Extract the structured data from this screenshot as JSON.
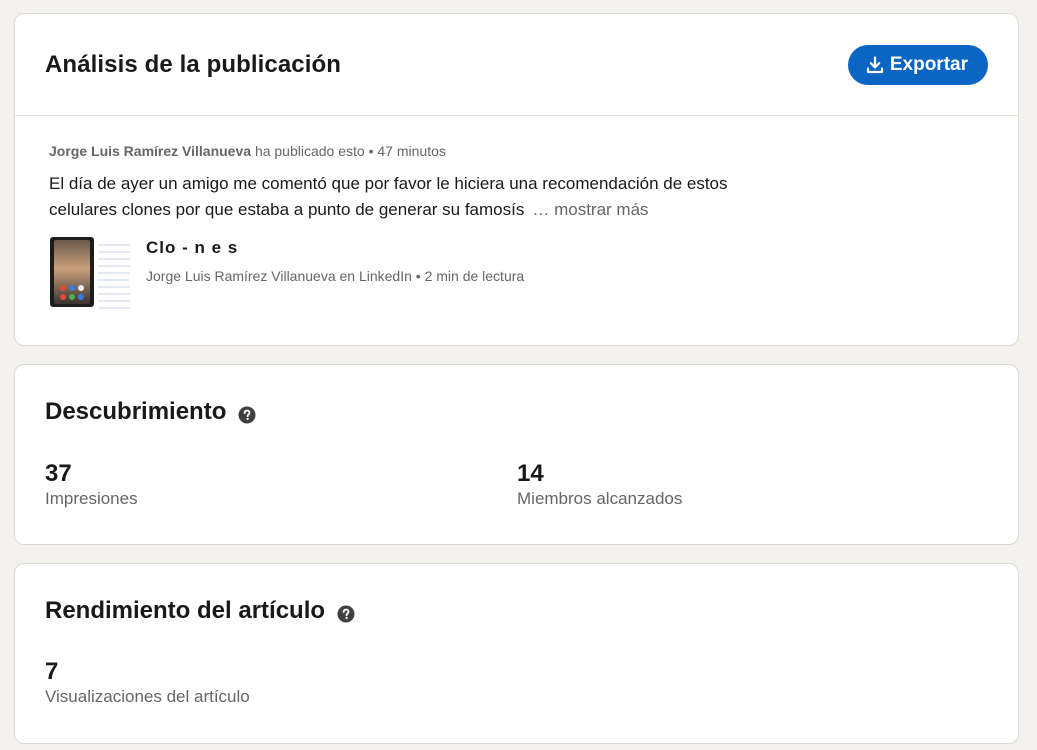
{
  "analysis": {
    "title": "Análisis de la publicación",
    "export_label": "Exportar",
    "post": {
      "author": "Jorge Luis Ramírez Villanueva",
      "action": "ha publicado esto",
      "separator": "•",
      "time": "47 minutos",
      "text": "El día de ayer un amigo me comentó que por favor le hiciera una recomendación de estos celulares clones por que estaba a punto de generar su famosís",
      "show_more": "… mostrar más"
    },
    "article": {
      "title": "Clo - n e s",
      "subtitle": "Jorge Luis Ramírez Villanueva en LinkedIn • 2 min de lectura"
    }
  },
  "discovery": {
    "title": "Descubrimiento",
    "metrics": [
      {
        "value": "37",
        "label": "Impresiones"
      },
      {
        "value": "14",
        "label": "Miembros alcanzados"
      }
    ]
  },
  "article_performance": {
    "title": "Rendimiento del artículo",
    "metrics": [
      {
        "value": "7",
        "label": "Visualizaciones del artículo"
      }
    ]
  },
  "colors": {
    "accent": "#0a66c2",
    "page_background": "#f4f2ee",
    "muted_text": "#666666"
  },
  "icons": {
    "export": "download-icon",
    "help": "question-circle-icon"
  }
}
